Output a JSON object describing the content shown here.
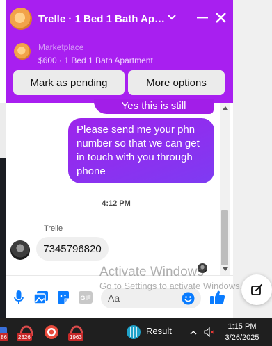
{
  "chat": {
    "title": "Trelle · 1 Bed 1 Bath Apart…",
    "marketplace_label": "Marketplace",
    "listing": "$600 · 1 Bed 1 Bath Apartment",
    "mark_pending_label": "Mark as pending",
    "more_options_label": "More options"
  },
  "messages": {
    "outgoing_partial": "Yes this is still available",
    "outgoing": "Please send me your phn number so that we can get in touch with you through phone",
    "timestamp": "4:12 PM",
    "sender": "Trelle",
    "incoming": "7345796820"
  },
  "composer": {
    "placeholder": "Aa"
  },
  "watermark": {
    "title": "Activate Windows",
    "subtitle": "Go to Settings to activate Windows."
  },
  "taskbar": {
    "badges": [
      "86",
      "2326",
      "1963"
    ],
    "weather_label": "Result",
    "time": "1:15 PM",
    "date": "3/26/2025"
  },
  "colors": {
    "brand": "#a81ff0",
    "outgoing_bubble": "#8b2ff0",
    "icon_blue": "#0a7cff",
    "taskbar": "#1f1f1f"
  }
}
